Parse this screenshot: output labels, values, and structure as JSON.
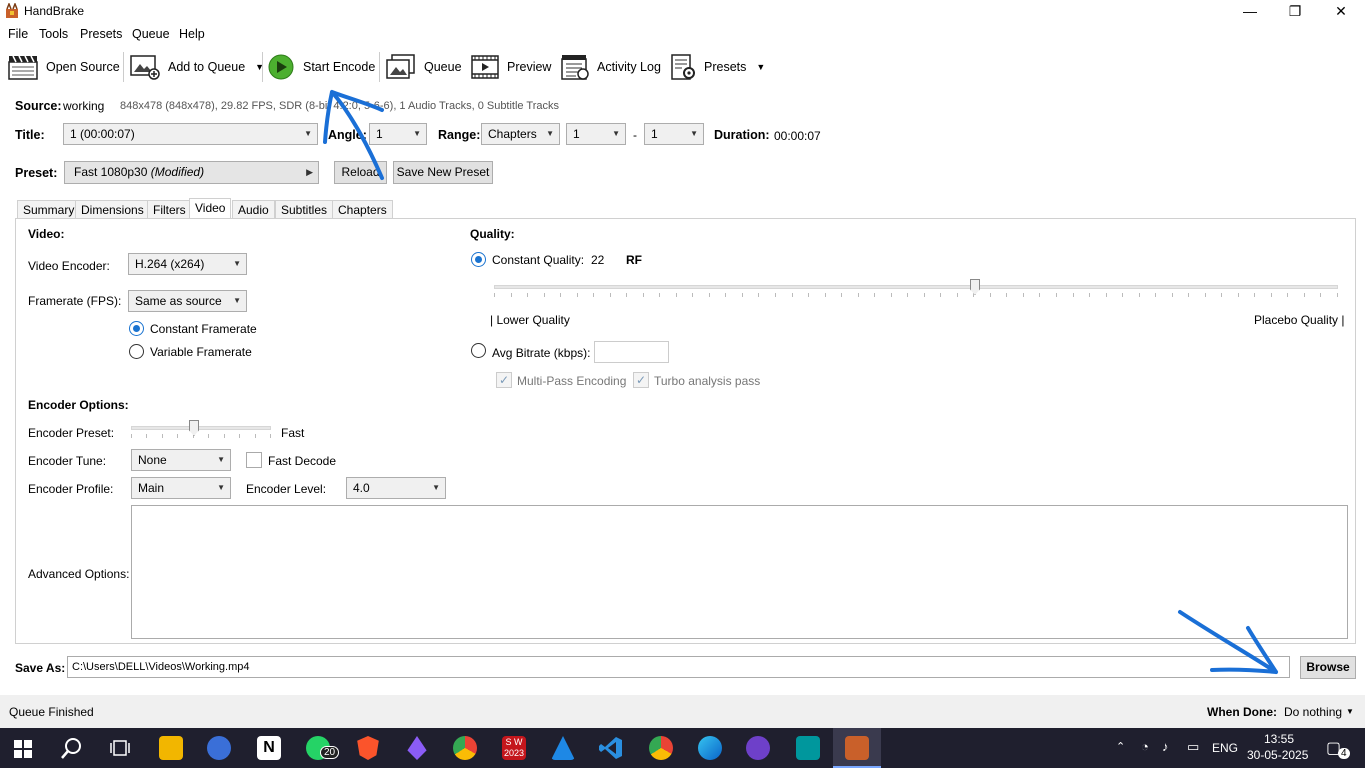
{
  "window": {
    "title": "HandBrake",
    "minimize": "—",
    "restore": "❐",
    "close": "✕"
  },
  "menu": [
    "File",
    "Tools",
    "Presets",
    "Queue",
    "Help"
  ],
  "toolbar": {
    "open_source": "Open Source",
    "add_to_queue": "Add to Queue",
    "start_encode": "Start Encode",
    "queue": "Queue",
    "preview": "Preview",
    "activity_log": "Activity Log",
    "presets": "Presets"
  },
  "source": {
    "label": "Source:",
    "name": "working",
    "info": "848x478 (848x478), 29.82 FPS, SDR (8-bit 4:2:0, 5-6-6), 1 Audio Tracks, 0 Subtitle Tracks"
  },
  "title_row": {
    "title_label": "Title:",
    "title_value": "1  (00:00:07)",
    "angle_label": "Angle:",
    "angle_value": "1",
    "range_label": "Range:",
    "range_value": "Chapters",
    "range_start": "1",
    "dash": "-",
    "range_end": "1",
    "duration_label": "Duration:",
    "duration_value": "00:00:07"
  },
  "preset_row": {
    "label": "Preset:",
    "value": "Fast 1080p30",
    "modified": "(Modified)",
    "reload": "Reload",
    "save_new": "Save New Preset"
  },
  "tabs": [
    "Summary",
    "Dimensions",
    "Filters",
    "Video",
    "Audio",
    "Subtitles",
    "Chapters"
  ],
  "active_tab": "Video",
  "video": {
    "heading": "Video:",
    "encoder_label": "Video Encoder:",
    "encoder_value": "H.264 (x264)",
    "framerate_label": "Framerate (FPS):",
    "framerate_value": "Same as source",
    "constant_fr": "Constant Framerate",
    "variable_fr": "Variable Framerate"
  },
  "quality": {
    "heading": "Quality:",
    "constant_label": "Constant Quality:",
    "constant_value": "22",
    "rf": "RF",
    "slider_fraction": 0.57,
    "lower": "| Lower Quality",
    "placebo": "Placebo Quality |",
    "avg_bitrate": "Avg Bitrate (kbps):",
    "multipass": "Multi-Pass Encoding",
    "turbo": "Turbo analysis pass"
  },
  "encoder_options": {
    "heading": "Encoder Options:",
    "preset_label": "Encoder Preset:",
    "preset_value": "Fast",
    "preset_fraction": 0.45,
    "tune_label": "Encoder Tune:",
    "tune_value": "None",
    "fast_decode": "Fast Decode",
    "profile_label": "Encoder Profile:",
    "profile_value": "Main",
    "level_label": "Encoder Level:",
    "level_value": "4.0",
    "advanced_label": "Advanced Options:"
  },
  "save_as": {
    "label": "Save As:",
    "path": "C:\\Users\\DELL\\Videos\\Working.mp4",
    "browse": "Browse"
  },
  "status": {
    "text": "Queue Finished",
    "when_done_label": "When Done:",
    "when_done_value": "Do nothing"
  },
  "taskbar": {
    "whatsapp_badge": "20",
    "sw_label": "S W",
    "sw_year": "2023",
    "lang": "ENG",
    "time": "13:55",
    "date": "30-05-2025",
    "notif_count": "4"
  },
  "colors": {
    "accent": "#1a73d0",
    "taskbar": "#1f1f2e",
    "annotation": "#1a6fd6"
  }
}
